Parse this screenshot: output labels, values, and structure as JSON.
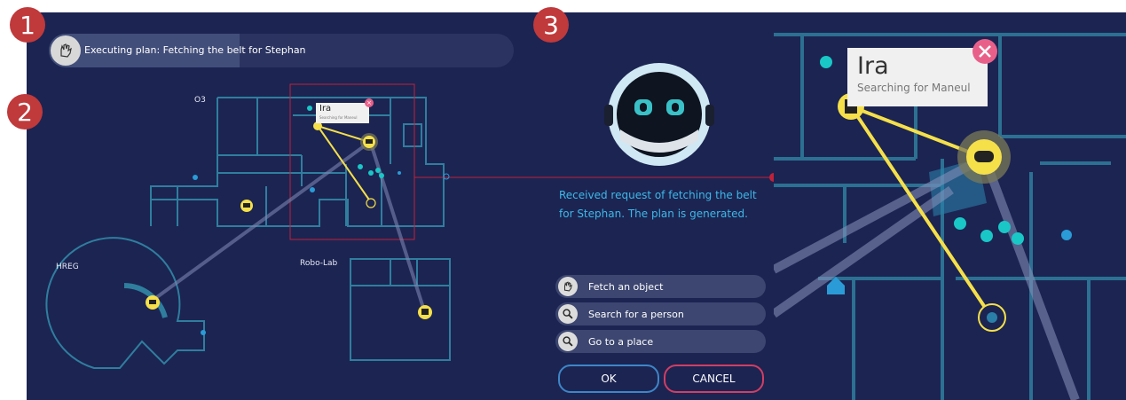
{
  "badges": [
    "1",
    "2",
    "3"
  ],
  "status": {
    "text": "Executing plan: Fetching the belt for Stephan",
    "icon": "hand-icon",
    "progress": 0.41
  },
  "map": {
    "labels": {
      "o3": "O3",
      "hreg": "HREG",
      "robo_lab": "Robo-Lab"
    },
    "popup": {
      "name": "Ira",
      "status": "Searching for Maneul"
    }
  },
  "message": "Received request of fetching the belt for Stephan. The plan is generated.",
  "actions": [
    {
      "label": "Fetch an object",
      "icon": "hand-icon"
    },
    {
      "label": "Search for a person",
      "icon": "search-icon"
    },
    {
      "label": "Go to a place",
      "icon": "search-icon"
    }
  ],
  "buttons": {
    "ok": "OK",
    "cancel": "CANCEL"
  },
  "zoom": {
    "popup": {
      "name": "Ira",
      "status": "Searching for Maneul"
    }
  },
  "colors": {
    "background": "#1c2452",
    "walls": "#2f7e9e",
    "accent_yellow": "#f5e04a",
    "teal_dot": "#19c7c7",
    "message_text": "#3db9e8",
    "selection_box": "#c0223a",
    "cancel_border": "#d13e64",
    "ok_border": "#3d86c8"
  }
}
